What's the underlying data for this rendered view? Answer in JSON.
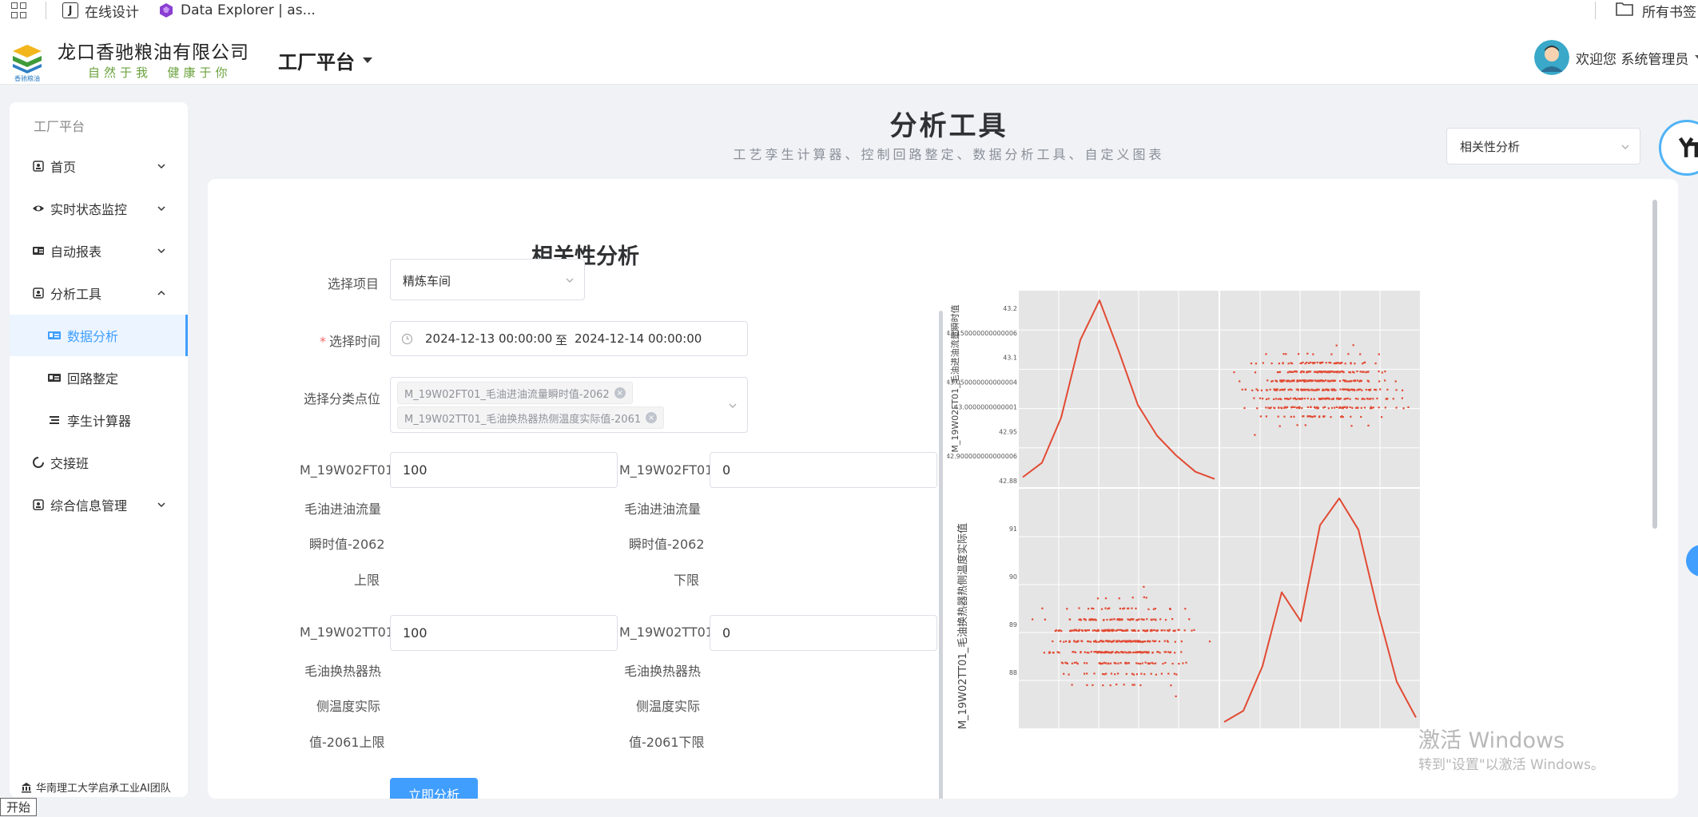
{
  "browser": {
    "bookmarks": [
      {
        "label": "在线设计",
        "icon": "j-favicon"
      },
      {
        "label": "Data Explorer | as...",
        "icon": "data-explorer-favicon"
      }
    ],
    "all_bookmarks": "所有书签"
  },
  "header": {
    "company": "龙口香驰粮油有限公司",
    "slogan": "自然于我  健康于你",
    "logo_text": "香驰粮油",
    "platform": "工厂平台",
    "welcome": "欢迎您 系统管理员"
  },
  "sidebar": {
    "title": "工厂平台",
    "items": [
      {
        "label": "首页",
        "icon": "home-icon",
        "expandable": true
      },
      {
        "label": "实时状态监控",
        "icon": "eye-icon",
        "expandable": true
      },
      {
        "label": "自动报表",
        "icon": "report-icon",
        "expandable": true
      },
      {
        "label": "分析工具",
        "icon": "analysis-icon",
        "expandable": true,
        "expanded": true
      },
      {
        "label": "数据分析",
        "icon": "data-card-icon",
        "sub": true,
        "active": true
      },
      {
        "label": "回路整定",
        "icon": "loop-card-icon",
        "sub": true
      },
      {
        "label": "孪生计算器",
        "icon": "list-icon",
        "sub": true
      },
      {
        "label": "交接班",
        "icon": "circle-icon",
        "expandable": false
      },
      {
        "label": "综合信息管理",
        "icon": "info-icon",
        "expandable": true
      }
    ],
    "footer": "华南理工大学启承工业AI团队"
  },
  "taskbar": {
    "start": "开始"
  },
  "page": {
    "title": "分析工具",
    "subtitle": "工艺孪生计算器、控制回路整定、数据分析工具、自定义图表",
    "tool_select": "相关性分析"
  },
  "form": {
    "title": "相关性分析",
    "project_label": "选择项目",
    "project_value": "精炼车间",
    "time_label": "选择时间",
    "time_start": "2024-12-13 00:00:00",
    "time_sep": "至",
    "time_end": "2024-12-14 00:00:00",
    "points_label": "选择分类点位",
    "points": [
      "M_19W02FT01_毛油进油流量瞬时值-2062",
      "M_19W02TT01_毛油换热器热侧温度实际值-2061"
    ],
    "limits": [
      {
        "lines": [
          "M_19W02FT01_",
          "毛油进油流量",
          "瞬时值-2062",
          "上限"
        ],
        "value": "100"
      },
      {
        "lines": [
          "M_19W02FT01_",
          "毛油进油流量",
          "瞬时值-2062",
          "下限"
        ],
        "value": "0"
      },
      {
        "lines": [
          "M_19W02TT01_",
          "毛油换热器热",
          "侧温度实际",
          "值-2061上限"
        ],
        "value": "100"
      },
      {
        "lines": [
          "M_19W02TT01_",
          "毛油换热器热",
          "侧温度实际",
          "值-2061下限"
        ],
        "value": "0"
      }
    ],
    "submit": "立即分析"
  },
  "chart_data": {
    "type": "scatter",
    "subtype": "pair-plot",
    "series_color": "#e24a33",
    "grid": true,
    "background": "#e5e5e5",
    "y_label_top": "M_19W02FT01_毛油进油流量瞬时值",
    "y_label_bottom": "M_19W02TT01_毛油换热器热侧温度实际值",
    "y_ticks_top": [
      "43.2",
      "43.150000000000006",
      "43.1",
      "43.050000000000004",
      "43.0000000000001",
      "42.95",
      "42.900000000000006",
      "42.88"
    ],
    "y_ticks_bottom": [
      "91",
      "90",
      "89",
      "88"
    ],
    "kde_top_left": {
      "x": [
        0.0,
        0.1,
        0.2,
        0.3,
        0.4,
        0.5,
        0.6,
        0.7,
        0.8,
        0.9,
        1.0
      ],
      "y": [
        0.02,
        0.1,
        0.35,
        0.78,
        1.0,
        0.72,
        0.42,
        0.25,
        0.14,
        0.05,
        0.01
      ]
    },
    "kde_bottom_right": {
      "x": [
        0.0,
        0.1,
        0.2,
        0.3,
        0.4,
        0.5,
        0.6,
        0.7,
        0.8,
        0.9,
        1.0
      ],
      "y": [
        0.0,
        0.05,
        0.25,
        0.58,
        0.45,
        0.88,
        1.0,
        0.86,
        0.5,
        0.18,
        0.02
      ]
    }
  },
  "watermark": {
    "line1": "激活 Windows",
    "line2": "转到\"设置\"以激活 Windows。"
  }
}
